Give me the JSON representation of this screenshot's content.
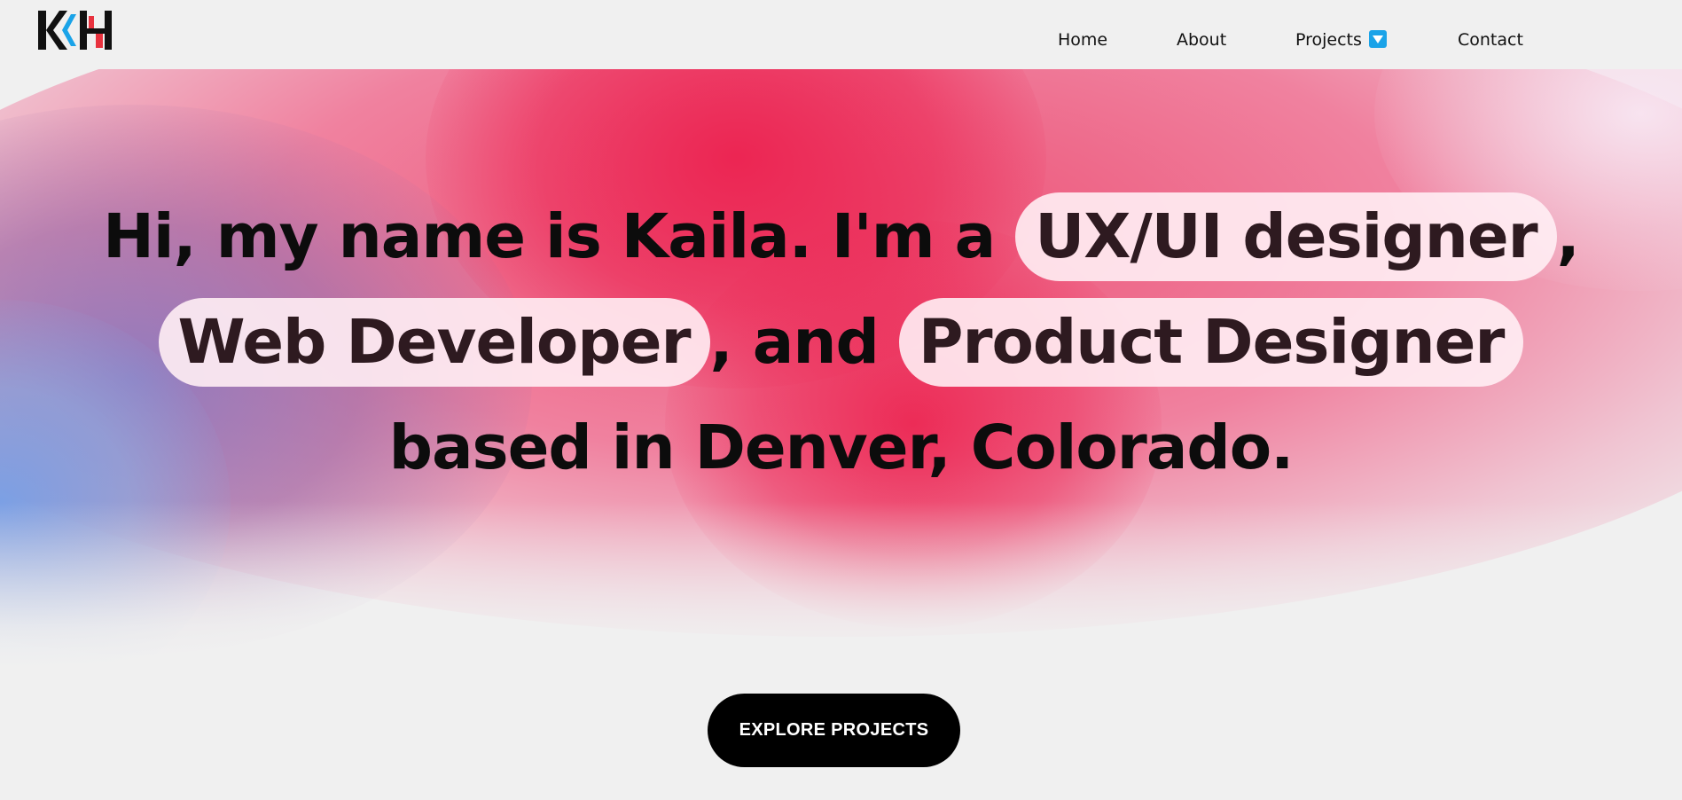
{
  "logo": {
    "text": "KH",
    "colors": {
      "dark": "#111111",
      "blue": "#1aa3e8",
      "red": "#e8323e"
    }
  },
  "nav": {
    "items": [
      {
        "label": "Home"
      },
      {
        "label": "About"
      },
      {
        "label": "Projects",
        "icon": "dropdown-arrow-icon"
      },
      {
        "label": "Contact"
      }
    ]
  },
  "hero": {
    "line1_prefix": "Hi, my name is Kaila. I'm a",
    "role1": "UX/UI designer",
    "comma1": ",",
    "role2": "Web Developer",
    "connector": ", and",
    "role3": "Product Designer",
    "line3": "based in Denver, Colorado."
  },
  "cta": {
    "label": "EXPLORE PROJECTS"
  },
  "colors": {
    "accent_red": "#ec2250",
    "accent_blue": "#1aa3e8",
    "button": "#000000",
    "background": "#f0f0f0"
  }
}
